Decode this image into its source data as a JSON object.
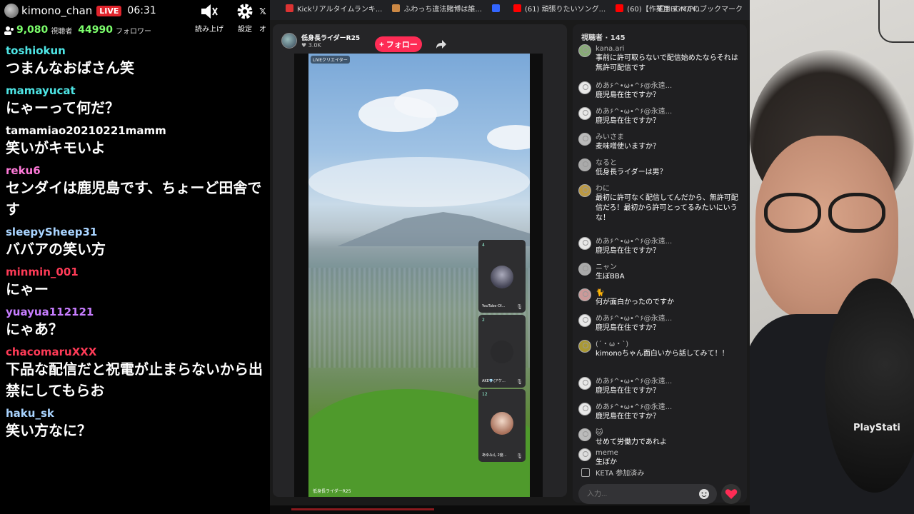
{
  "overlay": {
    "username": "kimono_chan",
    "live_label": "LIVE",
    "time": "06:31",
    "viewer_count": "9,080",
    "viewer_label": "視聴者",
    "follower_count": "44990",
    "follower_label": "フォロワー",
    "buttons": [
      {
        "label": "読み上げ",
        "icon": "speaker-icon"
      },
      {
        "label": "設定",
        "icon": "gear-icon"
      },
      {
        "label": "オ",
        "icon": "x-icon"
      }
    ],
    "messages": [
      {
        "name": "toshiokun",
        "color": "#4ee6e6",
        "text": "つまんなおばさん笑"
      },
      {
        "name": "mamayucat",
        "color": "#4ee6e6",
        "text": "にゃーって何だ？"
      },
      {
        "name": "tamamiao20210221mamm",
        "color": "#ffffff",
        "text": "笑いがキモいよ"
      },
      {
        "name": "reku6",
        "color": "#ff7ad9",
        "text": "センダイは鹿児島です、ちょーど田舎です"
      },
      {
        "name": "sleepySheep31",
        "color": "#a9d4ff",
        "text": "ババアの笑い方"
      },
      {
        "name": "minmin_001",
        "color": "#ff3b57",
        "text": "にゃー"
      },
      {
        "name": "yuayua112121",
        "color": "#c77dff",
        "text": "にゃあ？"
      },
      {
        "name": "chacomaruXXX",
        "color": "#ff3b57",
        "text": "下品な配信だと祝電が止まらないから出禁にしてもらお"
      },
      {
        "name": "haku_sk",
        "color": "#a9d4ff",
        "text": "笑い方なに？"
      }
    ]
  },
  "bookmarks": {
    "items": [
      {
        "label": "Kickリアルタイムランキ...",
        "color": "#d33"
      },
      {
        "label": "ふわっち違法賭博は誰...",
        "color": "#c84"
      },
      {
        "label": "",
        "color": "#36f"
      },
      {
        "label": "(61) 頑張りたいソング...",
        "color": "#f00"
      },
      {
        "label": "(60)【作業用BGM/Pl...",
        "color": "#f00"
      }
    ],
    "more": "»",
    "all_label": "すべてのブックマーク"
  },
  "stream": {
    "streamer_name": "低身長ライダーR25",
    "likes": "3.0K",
    "follow_label": "+ フォロー",
    "live_tag": "LIVEクリエイター",
    "caption": "低身長ライダーR25",
    "guests": [
      {
        "count": "4",
        "name": "YouTube-Ol...",
        "mic": "🎙"
      },
      {
        "count": "2",
        "name": "AKE💎(アケ...",
        "mic": "🎙"
      },
      {
        "count": "12",
        "name": "あゆみん 2度...",
        "mic": "🎙"
      }
    ]
  },
  "chat": {
    "header": "視聴者 · 145",
    "messages": [
      {
        "name": "kana.ari",
        "text": "事前に許可取らないで配信始めたならそれは無許可配信です",
        "ava": "#8a7"
      },
      {
        "name": "めあ۶^•ω•^۶@永遠...",
        "text": "鹿児島在住ですか？",
        "ava": "default"
      },
      {
        "name": "めあ۶^•ω•^۶@永遠...",
        "text": "鹿児島在住ですか？",
        "ava": "default"
      },
      {
        "name": "みいさま",
        "text": "麦味噌使いますか？",
        "ava": "#bbb"
      },
      {
        "name": "なると",
        "text": "低身長ライダーは男？",
        "ava": "#aaa"
      },
      {
        "name": "わに",
        "text": "最初に許可なく配信してんだから、無許可配信だろ！最初から許可とってるみたいにいうな！",
        "ava": "#b94"
      },
      {
        "name": "めあ۶^•ω•^۶@永遠...",
        "text": "鹿児島在住ですか？",
        "ava": "default"
      },
      {
        "name": "ニャン",
        "text": "生ぼBBA",
        "ava": "#aaa"
      },
      {
        "name": "🐈 ",
        "text": "何が面白かったのですか",
        "ava": "#c99"
      },
      {
        "name": "めあ۶^•ω•^۶@永遠...",
        "text": "鹿児島在住ですか？",
        "ava": "default"
      },
      {
        "name": "(´・ω・`)",
        "text": "kimonoちゃん面白いから話してみて！！",
        "ava": "#a93"
      },
      {
        "name": "めあ۶^•ω•^۶@永遠...",
        "text": "鹿児島在住ですか？",
        "ava": "default"
      },
      {
        "name": "めあ۶^•ω•^۶@永遠...",
        "text": "鹿児島在住ですか？",
        "ava": "default"
      },
      {
        "name": "🐱",
        "text": "せめて労働力であれよ",
        "ava": "#bbb"
      },
      {
        "name": "meme",
        "text": "生ぼか",
        "ava": "#ddd"
      }
    ],
    "joined_text": "KETA  参加済み",
    "input_placeholder": "入力..."
  },
  "webcam": {
    "shirt_logo": "PlayStati"
  },
  "colors": {
    "follow": "#fe2c55",
    "live": "#e0242c",
    "viewer_green": "#7cff6c"
  }
}
